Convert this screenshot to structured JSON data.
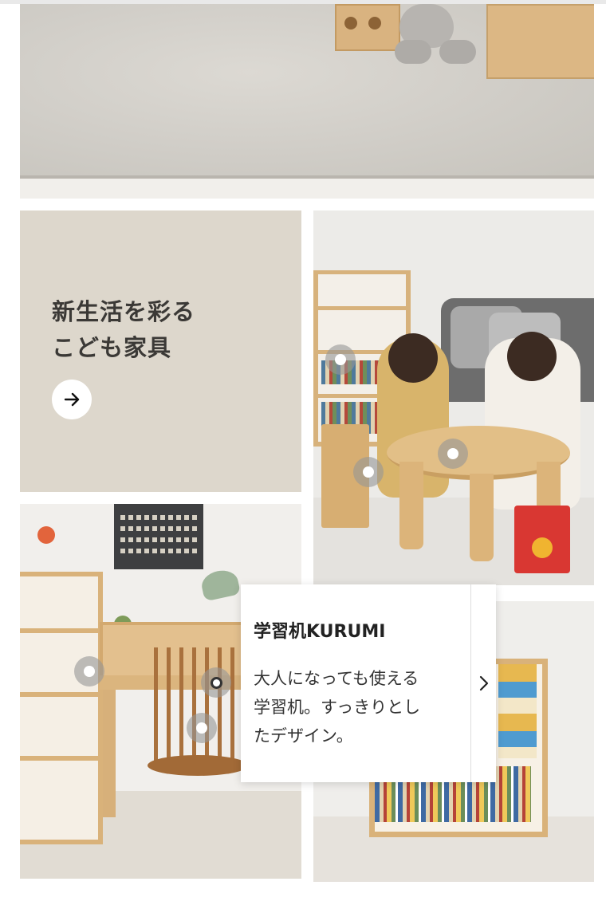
{
  "promo": {
    "title_line1": "新生活を彩る",
    "title_line2": "こども家具",
    "link_icon": "arrow-right-icon"
  },
  "product_tooltip": {
    "name": "学習机KURUMI",
    "description_line1": "大人になっても使える",
    "description_line2": "学習机。すっきりとし",
    "description_line3": "たデザイン。",
    "next_icon": "chevron-right-icon"
  },
  "colors": {
    "promo_background": "#ddd7cc",
    "promo_text": "#3b3936",
    "tooltip_background": "#ffffff",
    "hotspot_ring": "#969696"
  }
}
